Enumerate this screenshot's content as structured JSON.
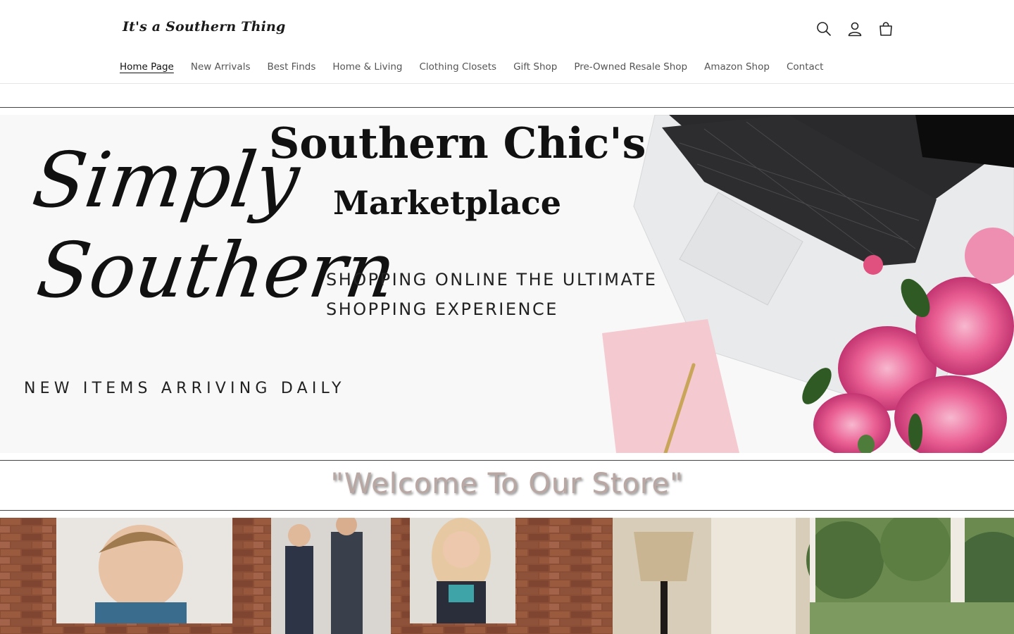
{
  "header": {
    "logo": "It's a Southern Thing",
    "icons": [
      "search-icon",
      "account-icon",
      "cart-icon"
    ]
  },
  "nav": {
    "items": [
      {
        "label": "Home Page",
        "active": true
      },
      {
        "label": "New Arrivals"
      },
      {
        "label": "Best Finds"
      },
      {
        "label": "Home & Living"
      },
      {
        "label": "Clothing Closets"
      },
      {
        "label": "Gift Shop"
      },
      {
        "label": "Pre-Owned Resale Shop"
      },
      {
        "label": "Amazon Shop"
      },
      {
        "label": "Contact"
      }
    ]
  },
  "hero": {
    "script_line1": "Simply",
    "script_line2": "Southern",
    "title": "Southern Chic's",
    "subtitle": "Marketplace",
    "tagline_1": "SHOPPING ONLINE THE ULTIMATE",
    "tagline_2": "SHOPPING EXPERIENCE",
    "new_items": "NEW ITEMS ARRIVING DAILY"
  },
  "welcome": {
    "text": "\"Welcome To Our Store\"",
    "color": "#b8a7a3"
  },
  "colors": {
    "nav_text": "#555555",
    "text": "#121212",
    "divider": "#444444"
  }
}
